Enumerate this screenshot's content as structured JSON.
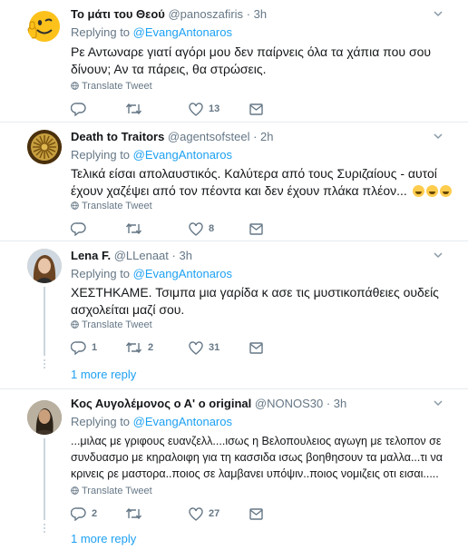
{
  "tweets": [
    {
      "name": "Το μάτι του Θεού",
      "handle": "@panoszafiris",
      "time": "3h",
      "replying_label": "Replying to",
      "replying_to": "@EvangAntonaros",
      "text": "Ρε Αντωναρε γιατί αγόρι μου δεν παίρνεις όλα τα χάπια που σου δίνουν; Αν τα πάρεις, θα στρώσεις.",
      "translate_label": "Translate Tweet",
      "replies": "",
      "retweets": "",
      "likes": "13",
      "avatar_icon": "thumbs-up-emoji-icon"
    },
    {
      "name": "Death to Traitors",
      "handle": "@agentsofsteel",
      "time": "2h",
      "replying_label": "Replying to",
      "replying_to": "@EvangAntonaros",
      "text": "Τελικά είσαι απολαυστικός. Καλύτερα από τους Συριζαίους - αυτοί έχουν χαζέψει από τον πέοντα και δεν έχουν πλάκα πλέον...",
      "emoji": [
        "laughing-emoji",
        "laughing-emoji",
        "laughing-emoji"
      ],
      "translate_label": "Translate Tweet",
      "replies": "",
      "retweets": "",
      "likes": "8",
      "avatar_icon": "vergina-sun-icon"
    },
    {
      "name": "Lena F.",
      "handle": "@LLenaat",
      "time": "3h",
      "replying_label": "Replying to",
      "replying_to": "@EvangAntonaros",
      "text": "ΧΕΣΤΗΚΑΜΕ. Τσιμπα μια γαρίδα κ ασε τις μυστικοπάθειες ουδείς ασχολείται μαζί σου.",
      "translate_label": "Translate Tweet",
      "replies": "1",
      "retweets": "2",
      "likes": "31",
      "more_reply": "1 more reply",
      "avatar_icon": "user-photo-icon"
    },
    {
      "name": "Κος Αυγολέμονος ο Α' ο original",
      "handle": "@NONOS30",
      "time": "3h",
      "replying_label": "Replying to",
      "replying_to": "@EvangAntonaros",
      "text": "...μιλας με γριφους ευανζελλ....ισως η Βελοπουλειος αγωγη με τελοπον σε συνδυασμο με κηραλοιφη για τη κασσιδα ισως βοηθησουν τα μαλλα...τι να κρινεις ρε μαστορα..ποιος σε λαμβανει υπόψιν..ποιος νομιζεις οτι εισαι.....",
      "translate_label": "Translate Tweet",
      "replies": "2",
      "retweets": "",
      "likes": "27",
      "more_reply": "1 more reply",
      "avatar_icon": "user-photo-icon"
    }
  ],
  "colors": {
    "link": "#1da1f2",
    "secondary": "#657786",
    "border": "#e6ecf0"
  }
}
